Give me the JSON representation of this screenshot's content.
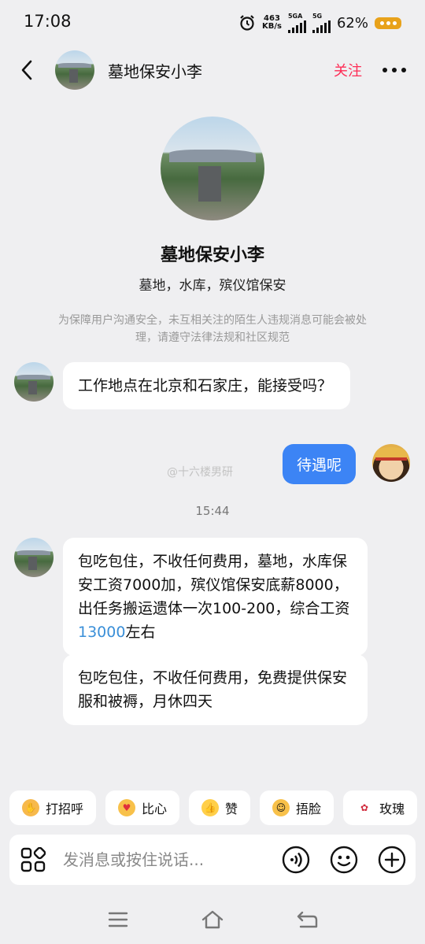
{
  "status_bar": {
    "time": "17:08",
    "net_speed_value": "463",
    "net_speed_unit": "KB/s",
    "sig1_label": "5GA",
    "sig2_label": "5G",
    "battery_percent": "62%"
  },
  "header": {
    "title": "墓地保安小李",
    "follow_label": "关注"
  },
  "profile": {
    "name": "墓地保安小李",
    "bio": "墓地，水库，殡仪馆保安",
    "notice": "为保障用户沟通安全，未互相关注的陌生人违规消息可能会被处理，请遵守法律法规和社区规范"
  },
  "messages": {
    "m1": "工作地点在北京和石家庄，能接受吗？",
    "m2": "待遇呢",
    "watermark": "@十六楼男研",
    "timestamp": "15:44",
    "m3_a": "包吃包住，不收任何费用，墓地，水库保安工资7000加，殡仪馆保安底薪8000，出任务搬运遗体一次100-200，综合工资",
    "m3_link": "13000",
    "m3_b": "左右",
    "m4": "包吃包住，不收任何费用，免费提供保安服和被褥，月休四天"
  },
  "quick_replies": [
    {
      "label": "打招呼",
      "icon": "wave-emoji-icon"
    },
    {
      "label": "比心",
      "icon": "heart-hands-emoji-icon"
    },
    {
      "label": "赞",
      "icon": "thumbs-up-icon"
    },
    {
      "label": "捂脸",
      "icon": "facepalm-emoji-icon"
    },
    {
      "label": "玫瑰",
      "icon": "rose-icon"
    }
  ],
  "input": {
    "placeholder": "发消息或按住说话..."
  },
  "colors": {
    "accent_blue": "#3c84f5",
    "follow_red": "#fe2c55",
    "background": "#efeff1",
    "battery": "#e8a21b"
  }
}
